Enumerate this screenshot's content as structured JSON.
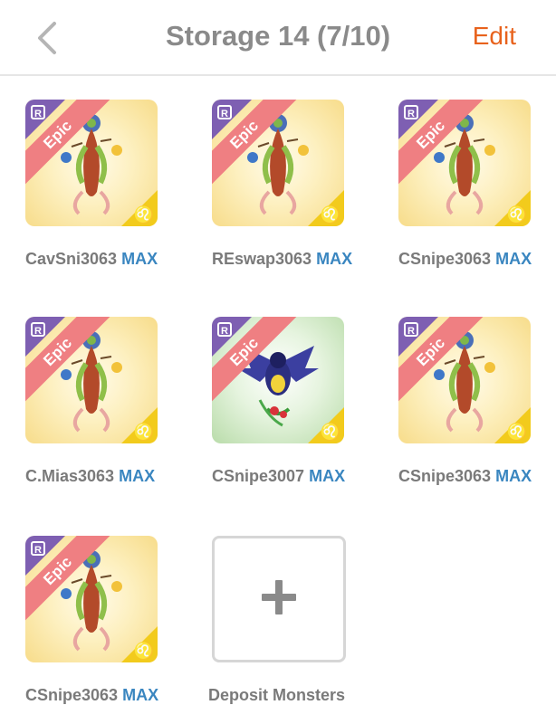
{
  "header": {
    "title": "Storage 14 (7/10)",
    "edit_label": "Edit",
    "back_icon": "chevron-left-icon"
  },
  "badges": {
    "rarity": "Epic",
    "r_label": "R",
    "zodiac": "♌"
  },
  "monsters": [
    {
      "name": "CavSni3063",
      "level": "MAX",
      "theme": "yellow"
    },
    {
      "name": "REswap3063",
      "level": "MAX",
      "theme": "yellow"
    },
    {
      "name": "CSnipe3063",
      "level": "MAX",
      "theme": "yellow"
    },
    {
      "name": "C.Mias3063",
      "level": "MAX",
      "theme": "yellow"
    },
    {
      "name": "CSnipe3007",
      "level": "MAX",
      "theme": "green"
    },
    {
      "name": "CSnipe3063",
      "level": "MAX",
      "theme": "yellow"
    },
    {
      "name": "CSnipe3063",
      "level": "MAX",
      "theme": "yellow"
    }
  ],
  "deposit": {
    "label": "Deposit Monsters",
    "icon": "plus-icon"
  },
  "colors": {
    "accent": "#e8621c",
    "max": "#3a86c0",
    "ribbon": "#ef7f82",
    "corner": "#7e5fb2",
    "zodiac": "#f2cb1c"
  }
}
